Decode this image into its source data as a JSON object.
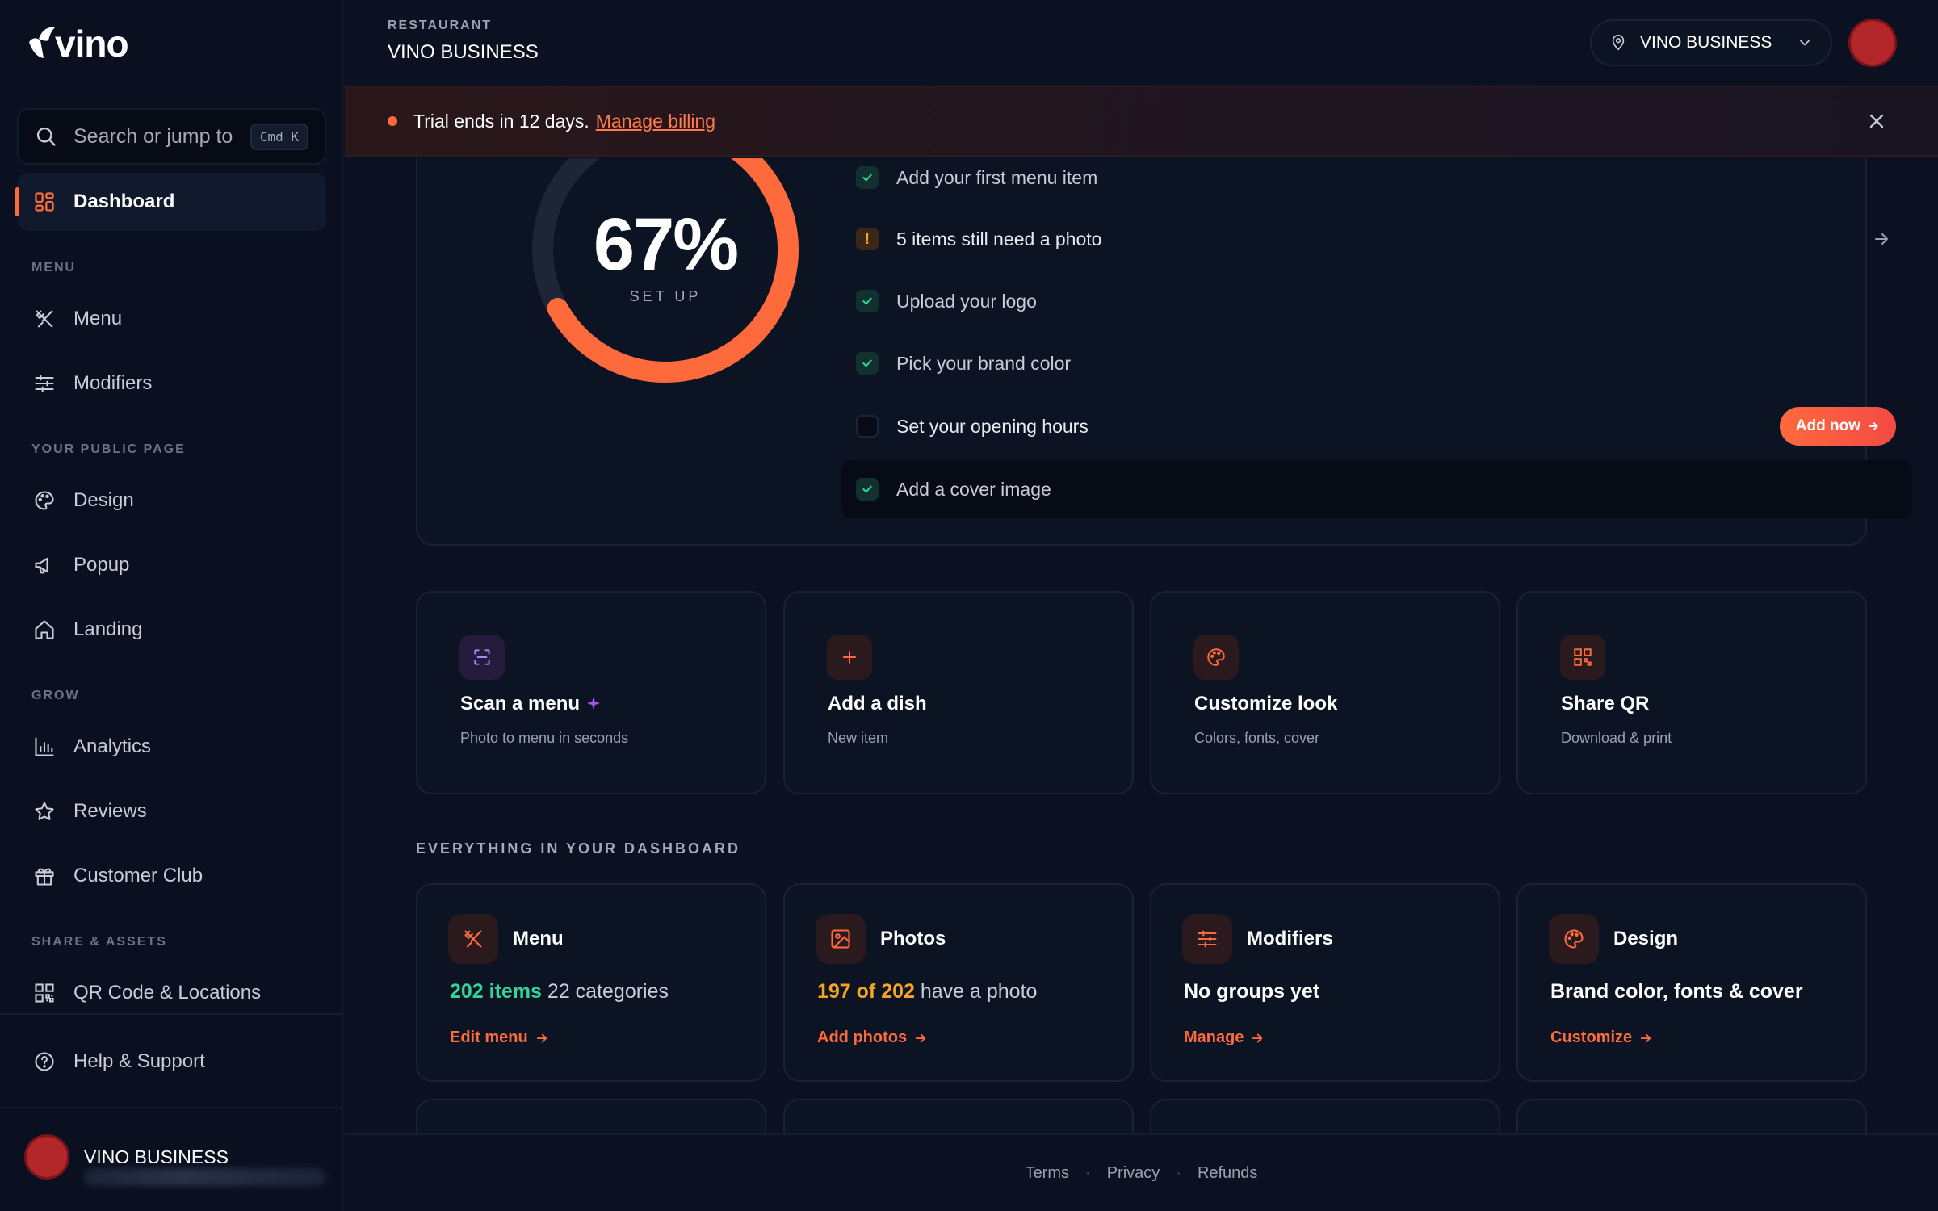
{
  "brand": {
    "logo_text": "vino",
    "accent": "#ff6a3d"
  },
  "sidebar": {
    "search": {
      "placeholder": "Search or jump to",
      "shortcut": "Cmd K"
    },
    "dashboard": "Dashboard",
    "sections": [
      {
        "label": "MENU",
        "items": [
          "Menu",
          "Modifiers"
        ]
      },
      {
        "label": "YOUR PUBLIC PAGE",
        "items": [
          "Design",
          "Popup",
          "Landing"
        ]
      },
      {
        "label": "GROW",
        "items": [
          "Analytics",
          "Reviews",
          "Customer Club"
        ]
      },
      {
        "label": "SHARE & ASSETS",
        "items": [
          "QR Code & Locations"
        ]
      }
    ],
    "help": "Help & Support",
    "profile_name": "VINO BUSINESS"
  },
  "header": {
    "eyebrow": "RESTAURANT",
    "title": "VINO BUSINESS",
    "location": "VINO BUSINESS"
  },
  "banner": {
    "text": "Trial ends in 12 days.",
    "link": "Manage billing"
  },
  "setup": {
    "percent_label": "67%",
    "percent": 0.67,
    "sublabel": "SET UP",
    "tasks": [
      {
        "label": "Add your first menu item",
        "status": "done"
      },
      {
        "label": "5 items still need a photo",
        "status": "warning"
      },
      {
        "label": "Upload your logo",
        "status": "done"
      },
      {
        "label": "Pick your brand color",
        "status": "done"
      },
      {
        "label": "Set your opening hours",
        "status": "todo",
        "action": "Add now"
      },
      {
        "label": "Add a cover image",
        "status": "done"
      }
    ]
  },
  "quick_actions": [
    {
      "title": "Scan a menu",
      "subtitle": "Photo to menu in seconds",
      "icon": "scan-icon"
    },
    {
      "title": "Add a dish",
      "subtitle": "New item",
      "icon": "plus-icon"
    },
    {
      "title": "Customize look",
      "subtitle": "Colors, fonts, cover",
      "icon": "palette-icon"
    },
    {
      "title": "Share QR",
      "subtitle": "Download & print",
      "icon": "qr-icon"
    }
  ],
  "dashboard_section": "EVERYTHING IN YOUR DASHBOARD",
  "tiles": [
    {
      "title": "Menu",
      "stat_strong": "202 items",
      "stat_rest": " 22 categories",
      "action": "Edit menu",
      "icon": "utensils-icon"
    },
    {
      "title": "Photos",
      "stat_strong": "197 of 202",
      "stat_rest": " have a photo",
      "action": "Add photos",
      "icon": "image-icon"
    },
    {
      "title": "Modifiers",
      "stat_strong": "No groups yet",
      "stat_rest": "",
      "action": "Manage",
      "icon": "sliders-icon"
    },
    {
      "title": "Design",
      "stat_strong": "Brand color, fonts & cover",
      "stat_rest": "",
      "action": "Customize",
      "icon": "palette-icon"
    }
  ],
  "footer": [
    "Terms",
    "Privacy",
    "Refunds"
  ]
}
